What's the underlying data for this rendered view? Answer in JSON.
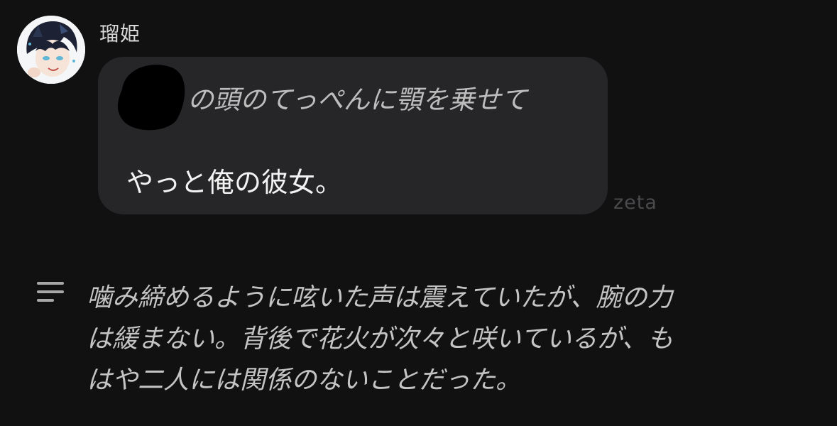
{
  "message": {
    "sender_name": "瑠姫",
    "avatar_icon": "character-portrait",
    "bubble_lines": [
      "の頭のてっぺんに顎を乗せて",
      "やっと俺の彼女。"
    ],
    "watermark": "zeta"
  },
  "narration": {
    "icon": "lines-icon",
    "lines": [
      "噛み締めるように呟いた声は震えていたが、腕の力",
      "は緩まない。背後で花火が次々と咲いているが、も",
      "はや二人には関係のないことだった。"
    ]
  },
  "colors": {
    "background": "#111112",
    "bubble": "#262628",
    "narration_text": "#c4c4c4",
    "watermark": "#4a4a4c"
  }
}
